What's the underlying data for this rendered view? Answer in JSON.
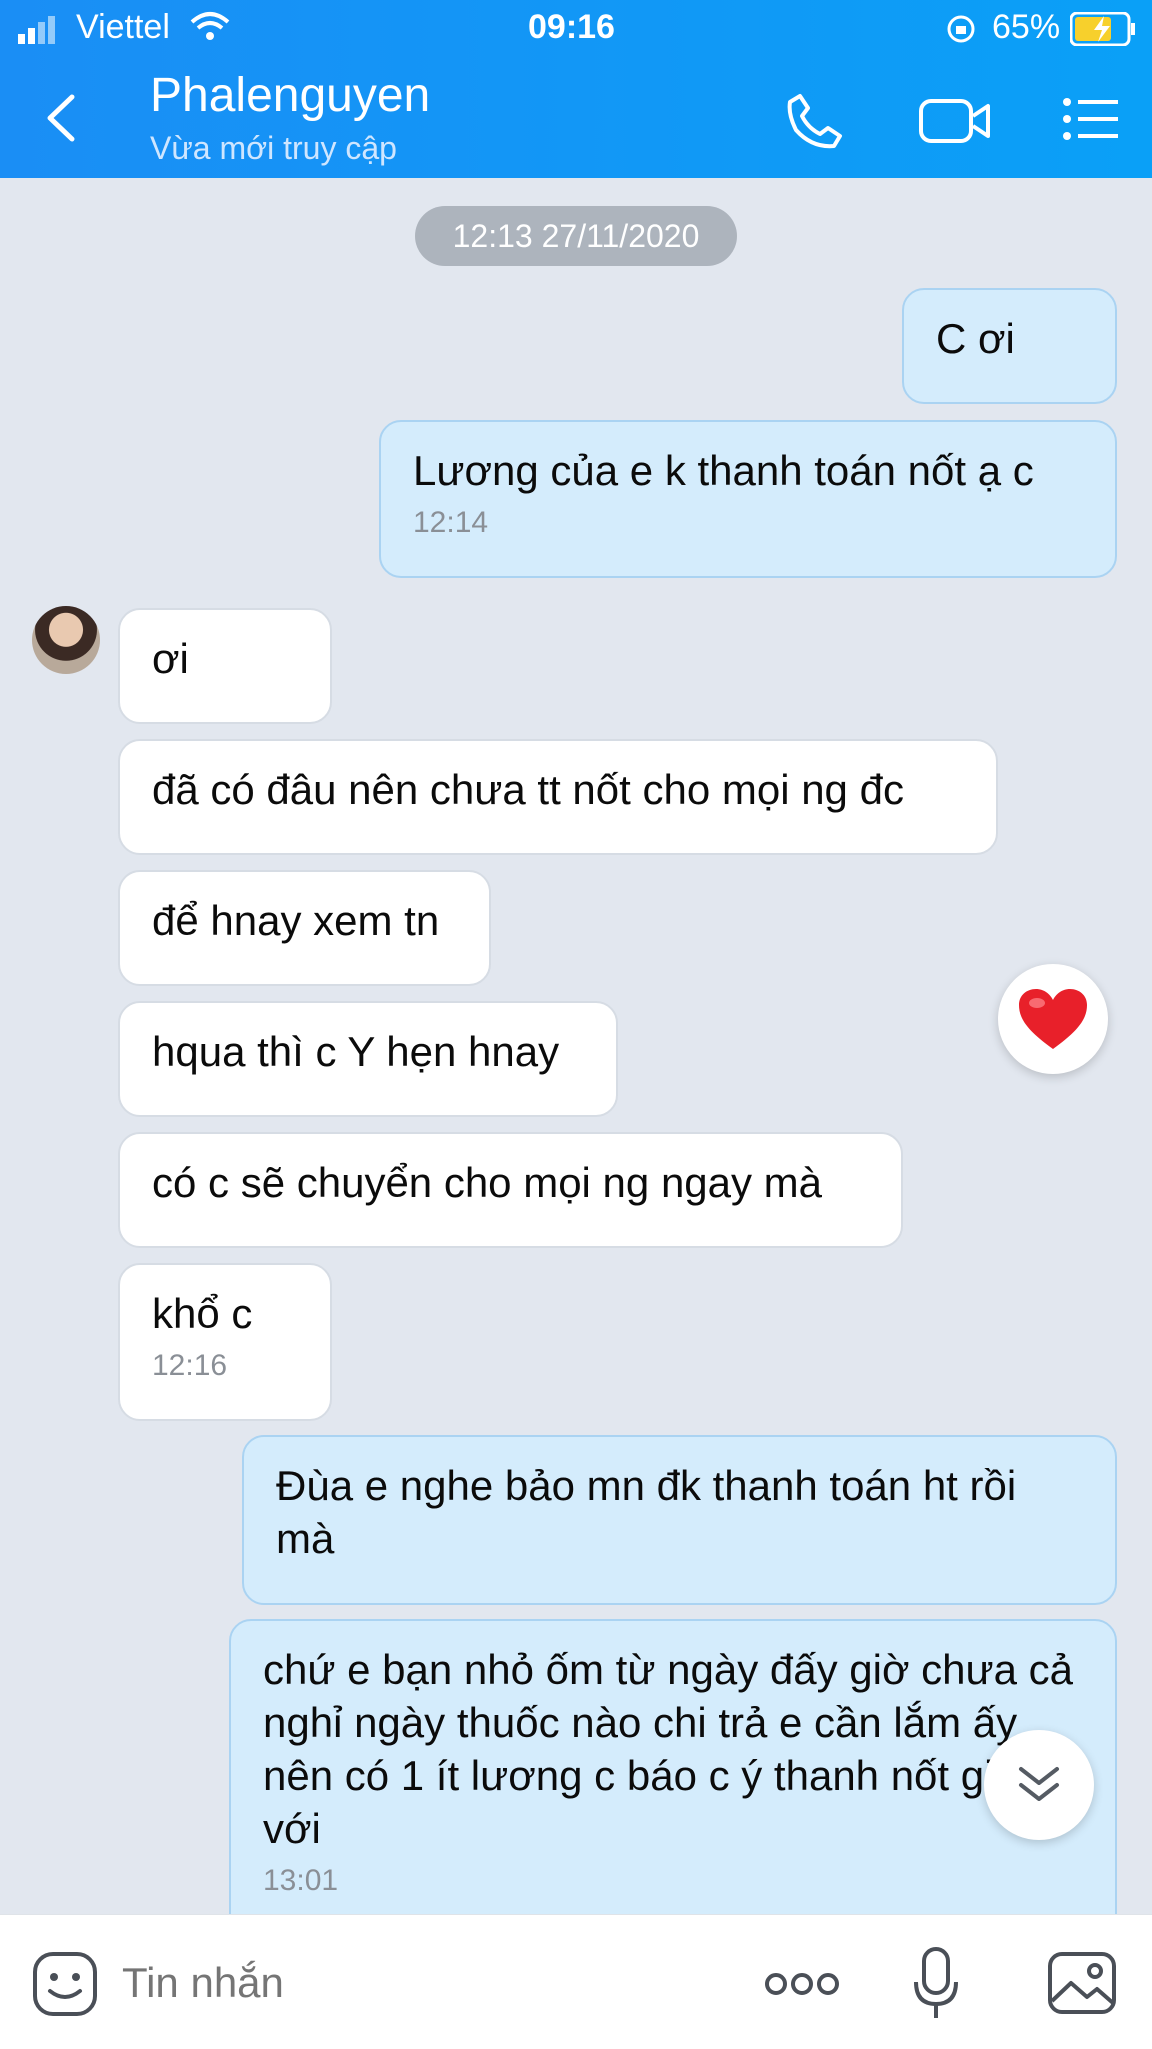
{
  "status_bar": {
    "carrier": "Viettel",
    "time": "09:16",
    "battery": "65%"
  },
  "header": {
    "contact_name": "Phalenguyen",
    "status": "Vừa mới truy cập",
    "icons": [
      "back-icon",
      "phone-icon",
      "video-icon",
      "menu-icon"
    ]
  },
  "chat": {
    "date_separator": "12:13 27/11/2020",
    "messages": [
      {
        "dir": "out",
        "text": "C ơi"
      },
      {
        "dir": "out",
        "text": "Lương của e k thanh toán nốt ạ c",
        "time": "12:14"
      },
      {
        "dir": "in",
        "text": "ơi"
      },
      {
        "dir": "in",
        "text": "đã có đâu nên chưa tt nốt cho mọi ng đc"
      },
      {
        "dir": "in",
        "text": "để hnay xem tn"
      },
      {
        "dir": "in",
        "text": "hqua thì c Y hẹn hnay"
      },
      {
        "dir": "in",
        "text": "có c sẽ chuyển cho mọi ng ngay mà"
      },
      {
        "dir": "in",
        "text": "khổ c",
        "time": "12:16"
      },
      {
        "dir": "out",
        "text": "Đùa e nghe bảo mn đk thanh toán ht rồi mà"
      },
      {
        "dir": "out",
        "text": "chứ e  bạn nhỏ ốm từ ngày đấy giờ chưa cả nghỉ ngày thuốc nào chi trả e cần lắm ấy nên có 1 ít lương c báo c ý thanh nốt giúp e với",
        "time": "13:01"
      }
    ]
  },
  "composer": {
    "placeholder": "Tin nhắn"
  },
  "colors": {
    "header": "#1a8ef5",
    "outgoing_bubble": "#d4ecfc",
    "incoming_bubble": "#ffffff",
    "background": "#e2e7ef",
    "heart": "#e8202a"
  }
}
